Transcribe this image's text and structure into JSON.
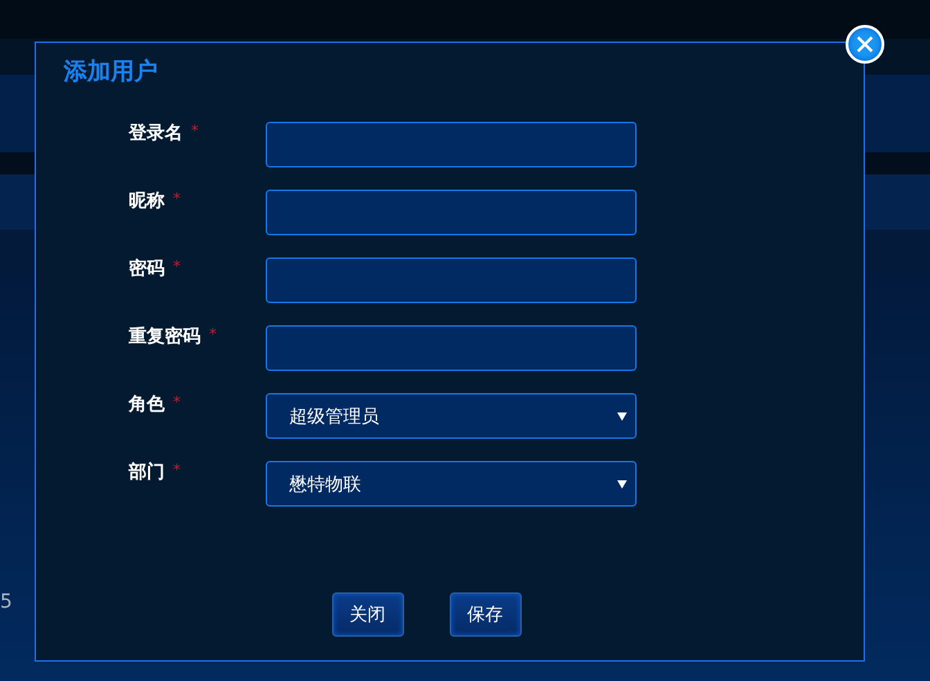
{
  "background": {
    "pager_fragment": "5"
  },
  "dialog": {
    "title": "添加用户",
    "fields": [
      {
        "label": "登录名",
        "required_mark": "*",
        "kind": "text"
      },
      {
        "label": "昵称",
        "required_mark": "*",
        "kind": "text"
      },
      {
        "label": "密码",
        "required_mark": "*",
        "kind": "text"
      },
      {
        "label": "重复密码",
        "required_mark": "*",
        "kind": "text"
      },
      {
        "label": "角色",
        "required_mark": "*",
        "kind": "select",
        "value": "超级管理员"
      },
      {
        "label": "部门",
        "required_mark": "*",
        "kind": "select",
        "value": "懋特物联"
      }
    ],
    "buttons": [
      "关闭",
      "保存"
    ]
  }
}
